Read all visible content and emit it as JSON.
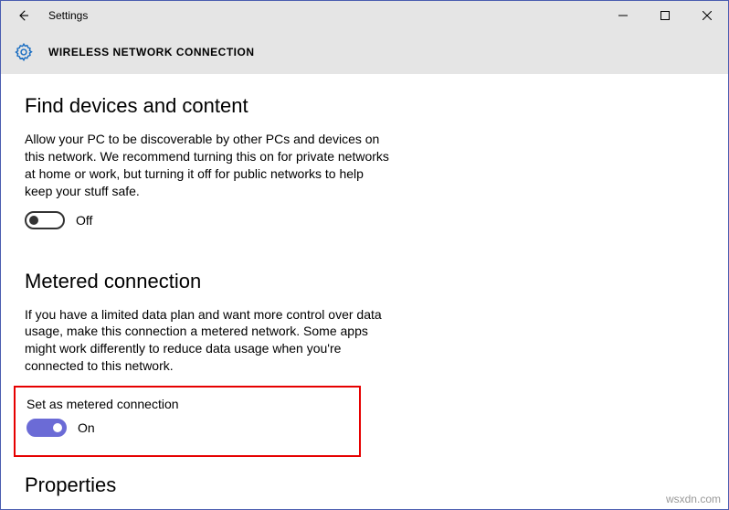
{
  "titlebar": {
    "app_title": "Settings"
  },
  "header": {
    "page_title": "WIRELESS NETWORK CONNECTION"
  },
  "section1": {
    "title": "Find devices and content",
    "description": "Allow your PC to be discoverable by other PCs and devices on this network. We recommend turning this on for private networks at home or work, but turning it off for public networks to help keep your stuff safe.",
    "toggle_state": "Off"
  },
  "section2": {
    "title": "Metered connection",
    "description": "If you have a limited data plan and want more control over data usage, make this connection a metered network. Some apps might work differently to reduce data usage when you're connected to this network.",
    "sub_label": "Set as metered connection",
    "toggle_state": "On"
  },
  "section3": {
    "title": "Properties"
  },
  "watermark": "wsxdn.com"
}
